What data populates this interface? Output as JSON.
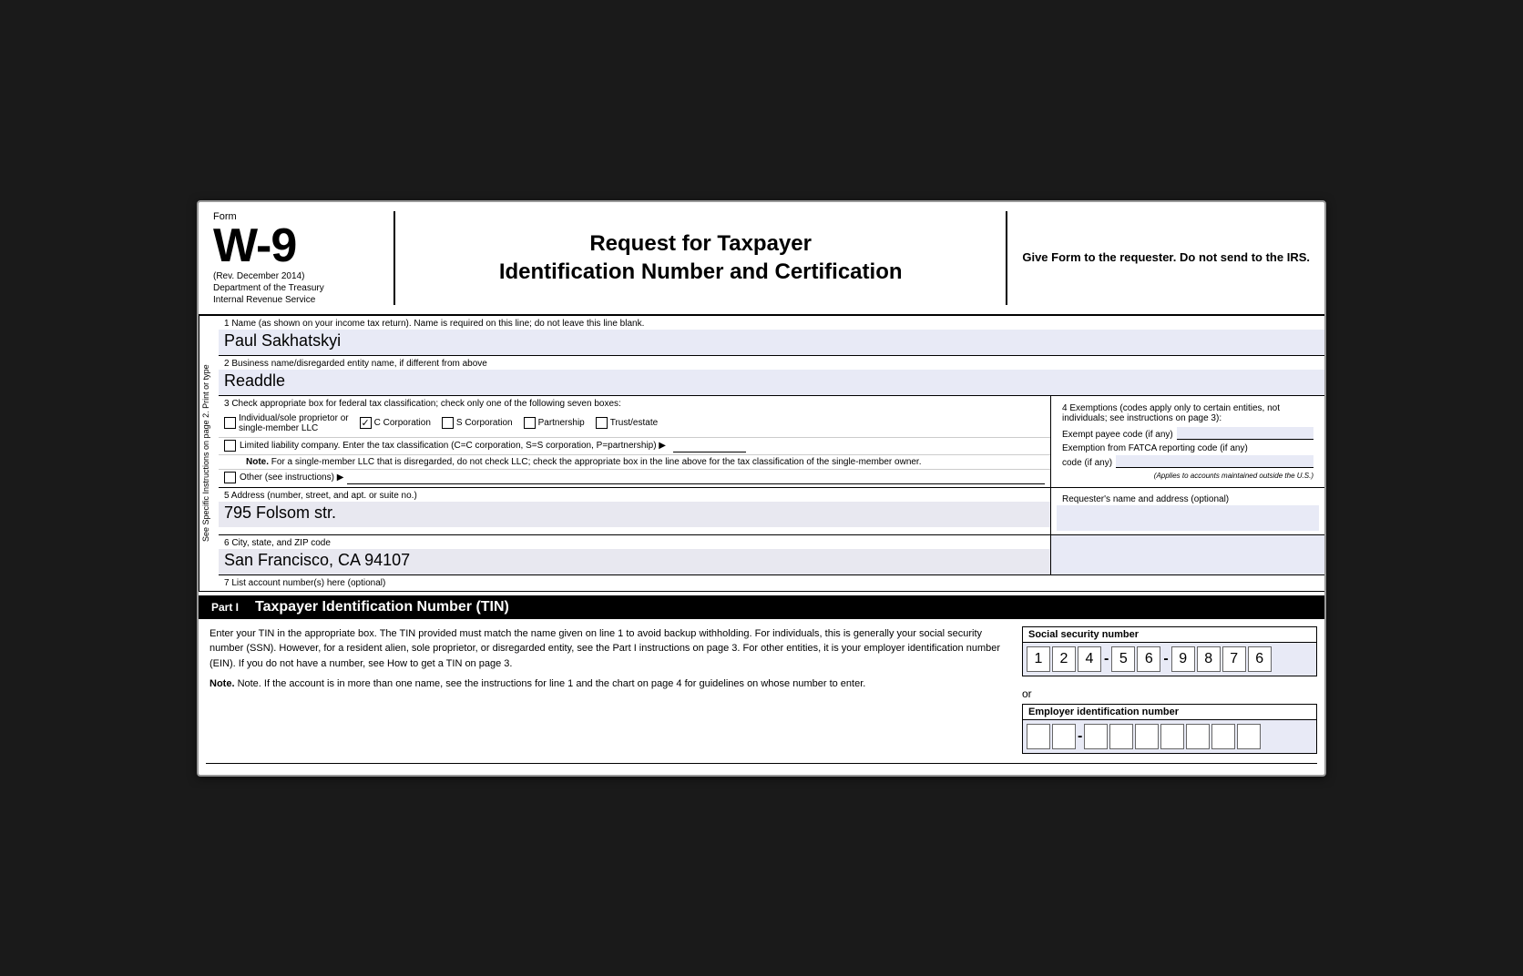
{
  "header": {
    "form_label": "Form",
    "form_number": "W-9",
    "rev_date": "(Rev. December 2014)",
    "dept_line1": "Department of the Treasury",
    "dept_line2": "Internal Revenue Service",
    "title_line1": "Request for Taxpayer",
    "title_line2": "Identification Number and Certification",
    "right_note": "Give Form to the requester. Do not send to the IRS."
  },
  "sidebar": {
    "text": "See Specific Instructions on page 2.     Print or type"
  },
  "fields": {
    "field1_label": "1  Name (as shown on your income tax return). Name is required on this line; do not leave this line blank.",
    "field1_value": "Paul Sakhatskyi",
    "field2_label": "2  Business name/disregarded entity name, if different from above",
    "field2_value": "Readdle",
    "field3_label": "3  Check appropriate box for federal tax classification; check only one of the following seven boxes:",
    "classifications": [
      {
        "id": "individual",
        "label": "Individual/sole proprietor or single-member LLC",
        "checked": false
      },
      {
        "id": "c_corp",
        "label": "C Corporation",
        "checked": true
      },
      {
        "id": "s_corp",
        "label": "S Corporation",
        "checked": false
      },
      {
        "id": "partnership",
        "label": "Partnership",
        "checked": false
      },
      {
        "id": "trust",
        "label": "Trust/estate",
        "checked": false
      }
    ],
    "llc_label": "Limited liability company. Enter the tax classification (C=C corporation, S=S corporation, P=partnership) ▶",
    "note_label": "Note.",
    "note_text": "For a single-member LLC that is disregarded, do not check LLC; check the appropriate box in the line above for the tax classification of the single-member owner.",
    "other_label": "Other (see instructions) ▶",
    "field4_label": "4  Exemptions (codes apply only to certain entities, not individuals; see instructions on page 3):",
    "exempt_payee_label": "Exempt payee code (if any)",
    "fatca_label": "Exemption from FATCA reporting code (if any)",
    "applies_note": "(Applies to accounts maintained outside the U.S.)",
    "field5_label": "5  Address (number, street, and apt. or suite no.)",
    "field5_value": "795 Folsom str.",
    "requester_label": "Requester's name and address (optional)",
    "field6_label": "6  City, state, and ZIP code",
    "field6_value": "San Francisco, CA 94107",
    "field7_label": "7  List account number(s) here (optional)"
  },
  "part1": {
    "label": "Part I",
    "title": "Taxpayer Identification Number (TIN)",
    "description1": "Enter your TIN in the appropriate box. The TIN provided must match the name given on line 1 to avoid backup withholding. For individuals, this is generally your social security number (SSN). However, for a resident alien, sole proprietor, or disregarded entity, see the Part I instructions on page 3. For other entities, it is your employer identification number (EIN). If you do not have a number, see How to get a TIN on page 3.",
    "description2": "Note. If the account is in more than one name, see the instructions for line 1 and the chart on page 4 for guidelines on whose number to enter.",
    "ssn_label": "Social security number",
    "ssn_digits": [
      "1",
      "2",
      "4",
      "",
      "5",
      "6",
      "",
      "9",
      "8",
      "7",
      "6"
    ],
    "or_text": "or",
    "ein_label": "Employer identification number",
    "ein_digits": [
      "",
      "",
      "",
      "",
      "",
      "",
      "",
      "",
      ""
    ]
  }
}
